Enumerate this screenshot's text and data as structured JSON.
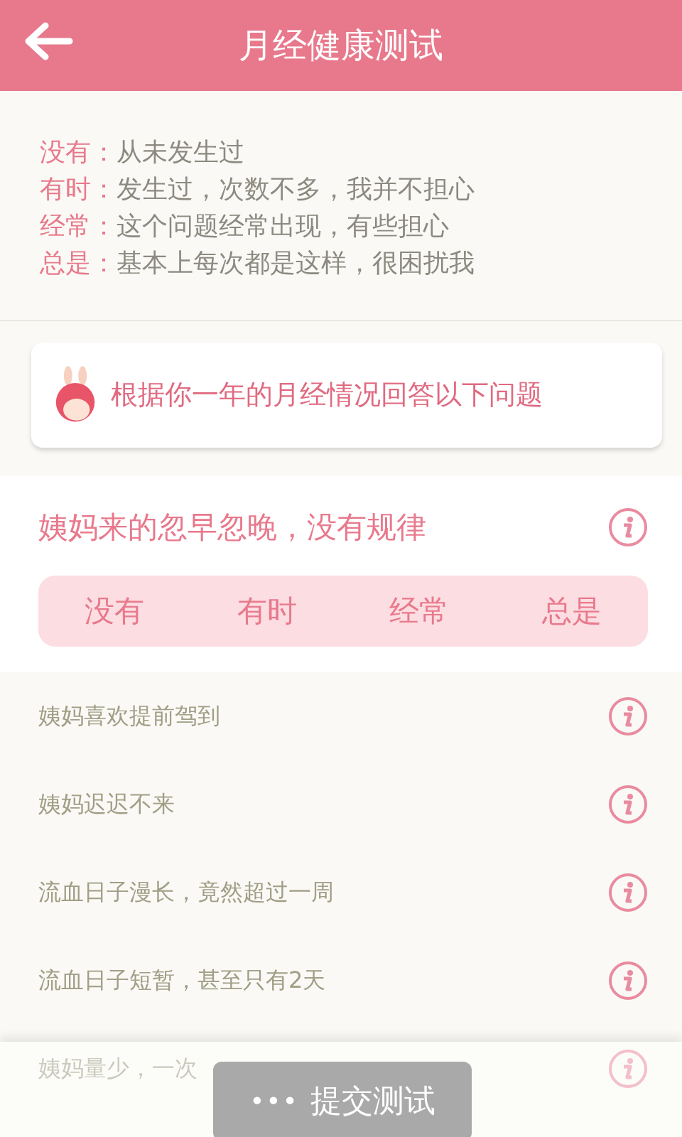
{
  "header": {
    "title": "月经健康测试"
  },
  "legend": [
    {
      "label": "没有：",
      "description": "从未发生过"
    },
    {
      "label": "有时：",
      "description": "发生过，次数不多，我并不担心"
    },
    {
      "label": "经常：",
      "description": "这个问题经常出现，有些担心"
    },
    {
      "label": "总是：",
      "description": "基本上每次都是这样，很困扰我"
    }
  ],
  "hint": "根据你一年的月经情况回答以下问题",
  "current_question": {
    "text": "姨妈来的忽早忽晚，没有规律",
    "options": [
      {
        "label": "没有",
        "selected": false
      },
      {
        "label": "有时",
        "selected": false
      },
      {
        "label": "经常",
        "selected": false
      },
      {
        "label": "总是",
        "selected": false
      }
    ]
  },
  "questions": [
    {
      "text": "姨妈喜欢提前驾到"
    },
    {
      "text": "姨妈迟迟不来"
    },
    {
      "text": "流血日子漫长，竟然超过一周"
    },
    {
      "text": "流血日子短暂，甚至只有2天"
    },
    {
      "text": "姨妈量少，一次"
    }
  ],
  "submit": {
    "icon": "•••",
    "label": "提交测试",
    "disabled": true
  }
}
